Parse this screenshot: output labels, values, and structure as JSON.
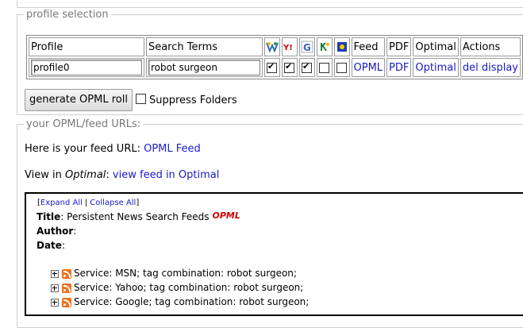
{
  "profile_section": {
    "legend": "profile selection",
    "headers": {
      "profile": "Profile",
      "search_terms": "Search Terms",
      "feed": "Feed",
      "pdf": "PDF",
      "optimal": "Optimal",
      "actions": "Actions"
    },
    "service_icons": [
      {
        "name": "msn-icon",
        "color": "#2f6db8"
      },
      {
        "name": "yahoo-icon",
        "color": "#cc0000"
      },
      {
        "name": "google-icon",
        "color": "#3366cc"
      },
      {
        "name": "technorati-icon",
        "color": "#1a7a3a"
      },
      {
        "name": "blog-icon",
        "color": "#1f3fb0"
      }
    ],
    "row": {
      "profile_value": "profile0",
      "search_value": "robot surgeon",
      "checks": [
        true,
        true,
        true,
        false,
        false
      ],
      "feed_link": "OPML",
      "pdf_link": "PDF",
      "optimal_link": "Optimal",
      "del_link": "del",
      "display_link": "display"
    },
    "generate_button": "generate OPML roll",
    "suppress_label": "Suppress Folders",
    "suppress_checked": false
  },
  "urls_section": {
    "legend": "your OPML/feed URLs:",
    "feed_prefix": "Here is your feed URL: ",
    "feed_link": "OPML Feed",
    "view_prefix": "View in ",
    "view_italic": "Optimal",
    "view_colon": ": ",
    "view_link": "view feed in Optimal"
  },
  "opml_view": {
    "expand_all": "Expand All",
    "separator": "|",
    "collapse_all": "Collapse All",
    "bracket_open": "[",
    "bracket_close": "]",
    "title_label": "Title",
    "title_value": "Persistent News Search Feeds",
    "opml_badge": "OPML",
    "author_label": "Author",
    "date_label": "Date",
    "services": [
      "Service: MSN; tag combination: robot surgeon;",
      "Service: Yahoo; tag combination: robot surgeon;",
      "Service: Google; tag combination: robot surgeon;"
    ]
  }
}
